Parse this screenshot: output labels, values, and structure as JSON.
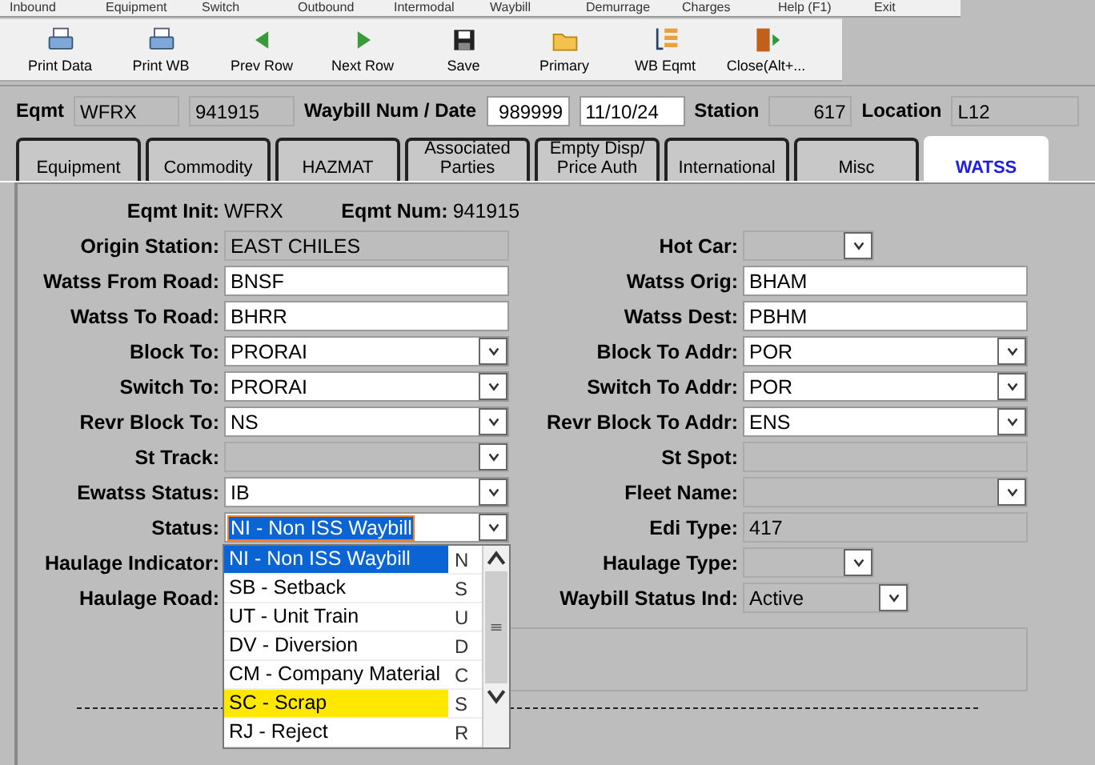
{
  "menu": [
    "Inbound",
    "Equipment",
    "Switch",
    "Outbound",
    "Intermodal",
    "Waybill",
    "Demurrage",
    "Charges",
    "Help (F1)",
    "Exit"
  ],
  "toolbar": [
    {
      "label": "Print Data",
      "kind": "printer"
    },
    {
      "label": "Print WB",
      "kind": "printer"
    },
    {
      "label": "Prev Row",
      "kind": "left"
    },
    {
      "label": "Next Row",
      "kind": "right"
    },
    {
      "label": "Save",
      "kind": "disk"
    },
    {
      "label": "Primary",
      "kind": "folder"
    },
    {
      "label": "WB Eqmt",
      "kind": "list"
    },
    {
      "label": "Close(Alt+...",
      "kind": "door"
    }
  ],
  "header": [
    {
      "kind": "label",
      "text": "Eqmt"
    },
    {
      "kind": "readonly",
      "text": "WFRX"
    },
    {
      "kind": "readonly",
      "text": "941915"
    },
    {
      "kind": "label",
      "text": "Waybill Num / Date"
    },
    {
      "kind": "input",
      "text": "989999"
    },
    {
      "kind": "input",
      "text": "11/10/24"
    },
    {
      "kind": "label",
      "text": "Station"
    },
    {
      "kind": "readonly",
      "text": "617"
    },
    {
      "kind": "label",
      "text": "Location"
    },
    {
      "kind": "readonly",
      "text": "L12"
    }
  ],
  "tabs": [
    {
      "label": "Equipment",
      "selected": false
    },
    {
      "label": "Commodity",
      "selected": false
    },
    {
      "label": "HAZMAT",
      "selected": false
    },
    {
      "label": "Associated Parties",
      "selected": false
    },
    {
      "label": "Empty Disp/ Price Auth",
      "selected": false
    },
    {
      "label": "International",
      "selected": false
    },
    {
      "label": "Misc",
      "selected": false
    },
    {
      "label": "WATSS",
      "selected": true
    }
  ],
  "eqmt_line": [
    {
      "label": "Eqmt Init:",
      "value": "WFRX"
    },
    {
      "label": "Eqmt Num:",
      "value": "941915"
    }
  ],
  "rows": [
    {
      "left": {
        "label": "Origin Station:",
        "kind": "readonly",
        "value": "EAST CHILES"
      },
      "right": {
        "label": "Hot Car:",
        "kind": "select-disabled"
      }
    },
    {
      "left": {
        "label": "Watss From Road:",
        "kind": "input",
        "value": "BNSF"
      },
      "right": {
        "label": "Watss Orig:",
        "kind": "input",
        "value": "BHAM"
      }
    },
    {
      "left": {
        "label": "Watss To Road:",
        "kind": "input",
        "value": "BHRR"
      },
      "right": {
        "label": "Watss Dest:",
        "kind": "input",
        "value": "PBHM"
      }
    },
    {
      "left": {
        "label": "Block To:",
        "kind": "select",
        "value": "PRORAI"
      },
      "right": {
        "label": "Block To Addr:",
        "kind": "select",
        "value": "POR"
      }
    },
    {
      "left": {
        "label": "Switch To:",
        "kind": "select",
        "value": "PRORAI"
      },
      "right": {
        "label": "Switch To Addr:",
        "kind": "select",
        "value": "POR"
      }
    },
    {
      "left": {
        "label": "Revr Block To:",
        "kind": "select",
        "value": "NS"
      },
      "right": {
        "label": "Revr Block To Addr:",
        "kind": "select",
        "value": "ENS"
      }
    },
    {
      "left": {
        "label": "St Track:",
        "kind": "select-disabled"
      },
      "right": {
        "label": "St Spot:",
        "kind": "readonly"
      }
    },
    {
      "left": {
        "label": "Ewatss Status:",
        "kind": "select",
        "value": "IB"
      },
      "right": {
        "label": "Fleet Name:",
        "kind": "select-disabled"
      }
    },
    {
      "left": {
        "label": "Status:",
        "kind": "select-focused",
        "value": "NI - Non ISS Waybill"
      },
      "right": {
        "label": "Edi Type:",
        "kind": "readonly",
        "value": "417"
      }
    },
    {
      "left": {
        "label": "Haulage Indicator:",
        "kind": "hidden"
      },
      "right": {
        "label": "Haulage Type:",
        "kind": "select-disabled"
      }
    },
    {
      "left": {
        "label": "Haulage Road:",
        "kind": "hidden"
      },
      "right": {
        "label": "Waybill Status Ind:",
        "kind": "select-disabled",
        "value": "Active"
      }
    }
  ],
  "dropdown": [
    {
      "text": "NI - Non ISS Waybill",
      "column_2": "N",
      "selected": true,
      "highlighted": false
    },
    {
      "text": "SB - Setback",
      "column_2": "S",
      "selected": false,
      "highlighted": false
    },
    {
      "text": "UT - Unit Train",
      "column_2": "U",
      "selected": false,
      "highlighted": false
    },
    {
      "text": "DV - Diversion",
      "column_2": "D",
      "selected": false,
      "highlighted": false
    },
    {
      "text": "CM - Company Material",
      "column_2": "C",
      "selected": false,
      "highlighted": false
    },
    {
      "text": "SC - Scrap",
      "column_2": "S",
      "selected": false,
      "highlighted": true
    },
    {
      "text": "RJ - Reject",
      "column_2": "R",
      "selected": false,
      "highlighted": false
    }
  ]
}
